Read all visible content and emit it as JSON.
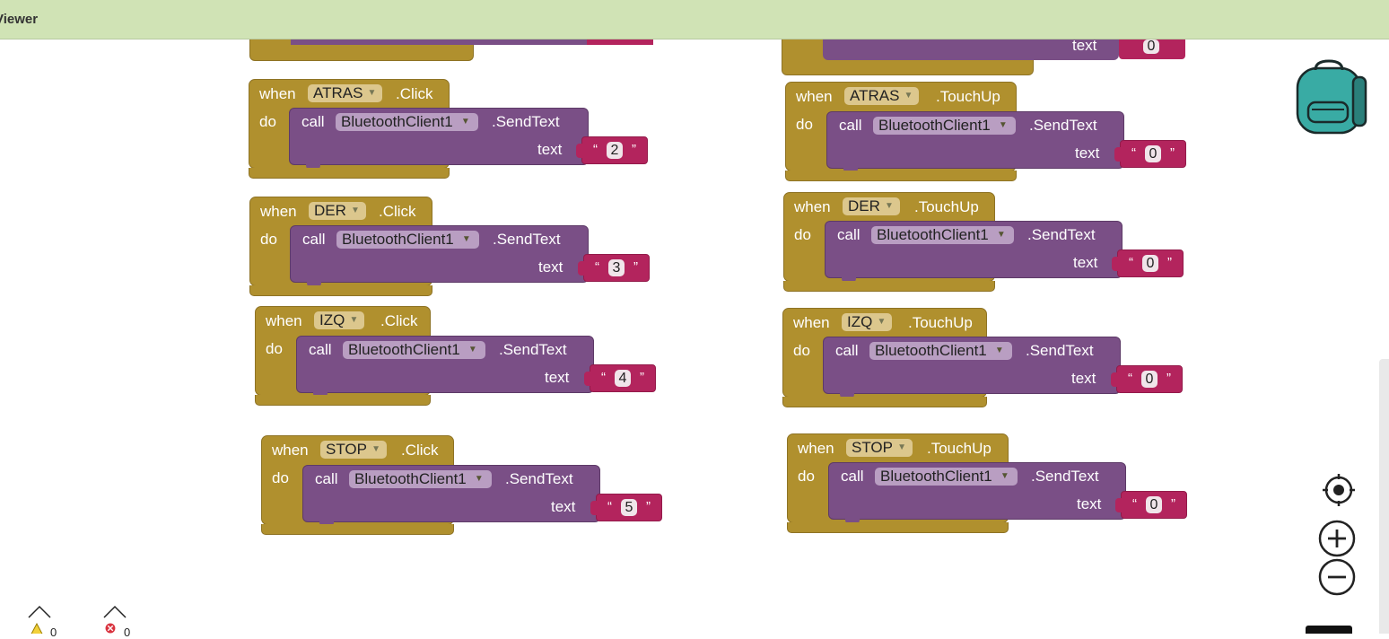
{
  "header": {
    "title": "Viewer"
  },
  "blocks": [
    {
      "when": "when",
      "component": "ATRAS",
      "event": ".Click",
      "do": "do",
      "call": "call",
      "client": "BluetoothClient1",
      "method": ".SendText",
      "param": "text",
      "value": "2"
    },
    {
      "when": "when",
      "component": "DER",
      "event": ".Click",
      "do": "do",
      "call": "call",
      "client": "BluetoothClient1",
      "method": ".SendText",
      "param": "text",
      "value": "3"
    },
    {
      "when": "when",
      "component": "IZQ",
      "event": ".Click",
      "do": "do",
      "call": "call",
      "client": "BluetoothClient1",
      "method": ".SendText",
      "param": "text",
      "value": "4"
    },
    {
      "when": "when",
      "component": "STOP",
      "event": ".Click",
      "do": "do",
      "call": "call",
      "client": "BluetoothClient1",
      "method": ".SendText",
      "param": "text",
      "value": "5"
    },
    {
      "when": "when",
      "component": "ATRAS",
      "event": ".TouchUp",
      "do": "do",
      "call": "call",
      "client": "BluetoothClient1",
      "method": ".SendText",
      "param": "text",
      "value": "0"
    },
    {
      "when": "when",
      "component": "DER",
      "event": ".TouchUp",
      "do": "do",
      "call": "call",
      "client": "BluetoothClient1",
      "method": ".SendText",
      "param": "text",
      "value": "0"
    },
    {
      "when": "when",
      "component": "IZQ",
      "event": ".TouchUp",
      "do": "do",
      "call": "call",
      "client": "BluetoothClient1",
      "method": ".SendText",
      "param": "text",
      "value": "0"
    },
    {
      "when": "when",
      "component": "STOP",
      "event": ".TouchUp",
      "do": "do",
      "call": "call",
      "client": "BluetoothClient1",
      "method": ".SendText",
      "param": "text",
      "value": "0"
    }
  ],
  "partial_top": {
    "param": "text",
    "value": "0"
  },
  "status": {
    "warnings": "0",
    "errors": "0"
  },
  "icons": {
    "backpack": "backpack-icon",
    "recenter": "target-icon",
    "zoom_in": "zoom-in-icon",
    "zoom_out": "zoom-out-icon",
    "warning": "warning-icon",
    "error": "error-icon",
    "trash": "trash-icon"
  },
  "colors": {
    "event_block": "#b0902e",
    "call_block": "#7a4f86",
    "text_block": "#b3245d",
    "header_bg": "#d0e3b5",
    "backpack": "#39aba4"
  }
}
